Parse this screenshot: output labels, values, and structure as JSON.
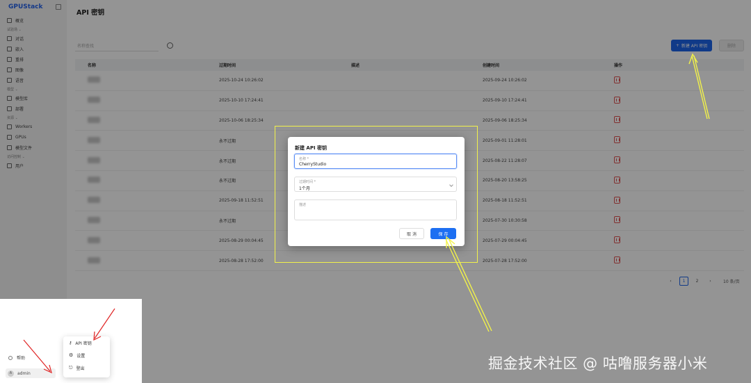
{
  "app": {
    "logo": "GPUStack",
    "page_title": "API 密钥"
  },
  "sidebar": {
    "items": [
      {
        "type": "item",
        "label": "概览",
        "icon": "dashboard-icon"
      },
      {
        "type": "group",
        "label": "试验场 ⌄"
      },
      {
        "type": "item",
        "label": "对话",
        "icon": "chat-icon"
      },
      {
        "type": "item",
        "label": "嵌入",
        "icon": "embed-icon"
      },
      {
        "type": "item",
        "label": "重排",
        "icon": "rerank-icon"
      },
      {
        "type": "item",
        "label": "图像",
        "icon": "image-icon"
      },
      {
        "type": "item",
        "label": "语音",
        "icon": "audio-icon"
      },
      {
        "type": "group",
        "label": "模型 ⌄"
      },
      {
        "type": "item",
        "label": "模型库",
        "icon": "catalog-icon"
      },
      {
        "type": "item",
        "label": "部署",
        "icon": "deploy-icon"
      },
      {
        "type": "group",
        "label": "资源 ⌄"
      },
      {
        "type": "item",
        "label": "Workers",
        "icon": "server-icon"
      },
      {
        "type": "item",
        "label": "GPUs",
        "icon": "gpu-icon"
      },
      {
        "type": "item",
        "label": "模型文件",
        "icon": "file-icon"
      },
      {
        "type": "group",
        "label": "访问控制 ⌄"
      },
      {
        "type": "item",
        "label": "用户",
        "icon": "user-icon"
      }
    ]
  },
  "toolbar": {
    "search_placeholder": "名称查找",
    "new_label": "新建 API 密钥",
    "delete_label": "删除"
  },
  "table": {
    "headers": [
      "名称",
      "过期时间",
      "描述",
      "创建时间",
      "操作"
    ],
    "rows": [
      {
        "expires": "2025-10-24 10:26:02",
        "created": "2025-09-24 10:26:02"
      },
      {
        "expires": "2025-10-10 17:24:41",
        "created": "2025-09-10 17:24:41"
      },
      {
        "expires": "2025-10-06 18:25:34",
        "created": "2025-09-06 18:25:34"
      },
      {
        "expires": "永不过期",
        "created": "2025-09-01 11:28:01"
      },
      {
        "expires": "永不过期",
        "created": "2025-08-22 11:28:07"
      },
      {
        "expires": "永不过期",
        "created": "2025-08-20 13:58:25"
      },
      {
        "expires": "2025-09-18 11:52:51",
        "created": "2025-08-18 11:52:51"
      },
      {
        "expires": "永不过期",
        "created": "2025-07-30 10:30:58"
      },
      {
        "expires": "2025-08-29 00:04:45",
        "created": "2025-07-29 00:04:45"
      },
      {
        "expires": "2025-08-28 17:52:00",
        "created": "2025-07-28 17:52:00"
      }
    ]
  },
  "pagination": {
    "prev": "‹",
    "pages": [
      "1",
      "2"
    ],
    "current": "1",
    "next": "›",
    "page_size": "10 条/页"
  },
  "modal": {
    "title": "新建 API 密钥",
    "name_label": "名称 *",
    "name_value": "CherryStudio",
    "expiry_label": "过期时间 *",
    "expiry_value": "1个月",
    "desc_placeholder": "描述",
    "cancel_label": "取 消",
    "save_label": "保 存"
  },
  "user_menu": {
    "help_label": "帮助",
    "username": "admin",
    "avatar_text": "A",
    "items": [
      {
        "label": "API 密钥",
        "icon": "key-icon"
      },
      {
        "label": "设置",
        "icon": "gear-icon"
      },
      {
        "label": "登出",
        "icon": "logout-icon"
      }
    ]
  },
  "watermark": "掘金技术社区 @ 咕噜服务器小米",
  "colors": {
    "primary": "#1d6ff2",
    "danger": "#e05252",
    "annotation": "#f2f24a"
  }
}
